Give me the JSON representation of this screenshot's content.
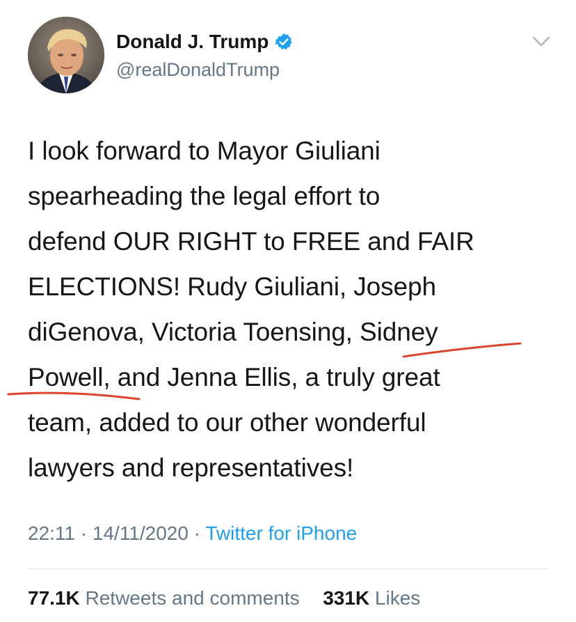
{
  "user": {
    "display_name": "Donald J. Trump",
    "handle": "@realDonaldTrump",
    "verified": true,
    "avatar_icon": "profile-photo"
  },
  "tweet": {
    "lines": [
      "I look forward to Mayor Giuliani",
      "spearheading the legal effort to",
      "defend OUR RIGHT to FREE and FAIR",
      "ELECTIONS! Rudy Giuliani, Joseph",
      "diGenova, Victoria Toensing, Sidney",
      "Powell, and Jenna Ellis, a truly great",
      "team, added to our other wonderful",
      "lawyers and representatives!"
    ],
    "annotation_color": "#d9442b"
  },
  "meta": {
    "time": "22:11",
    "separator": "·",
    "date": "14/11/2020",
    "source": "Twitter for iPhone"
  },
  "stats": {
    "retweets_count": "77.1K",
    "retweets_label": "Retweets and comments",
    "likes_count": "331K",
    "likes_label": "Likes"
  },
  "colors": {
    "text": "#14171a",
    "secondary": "#657786",
    "link": "#1da1f2",
    "verified": "#1da1f2"
  }
}
